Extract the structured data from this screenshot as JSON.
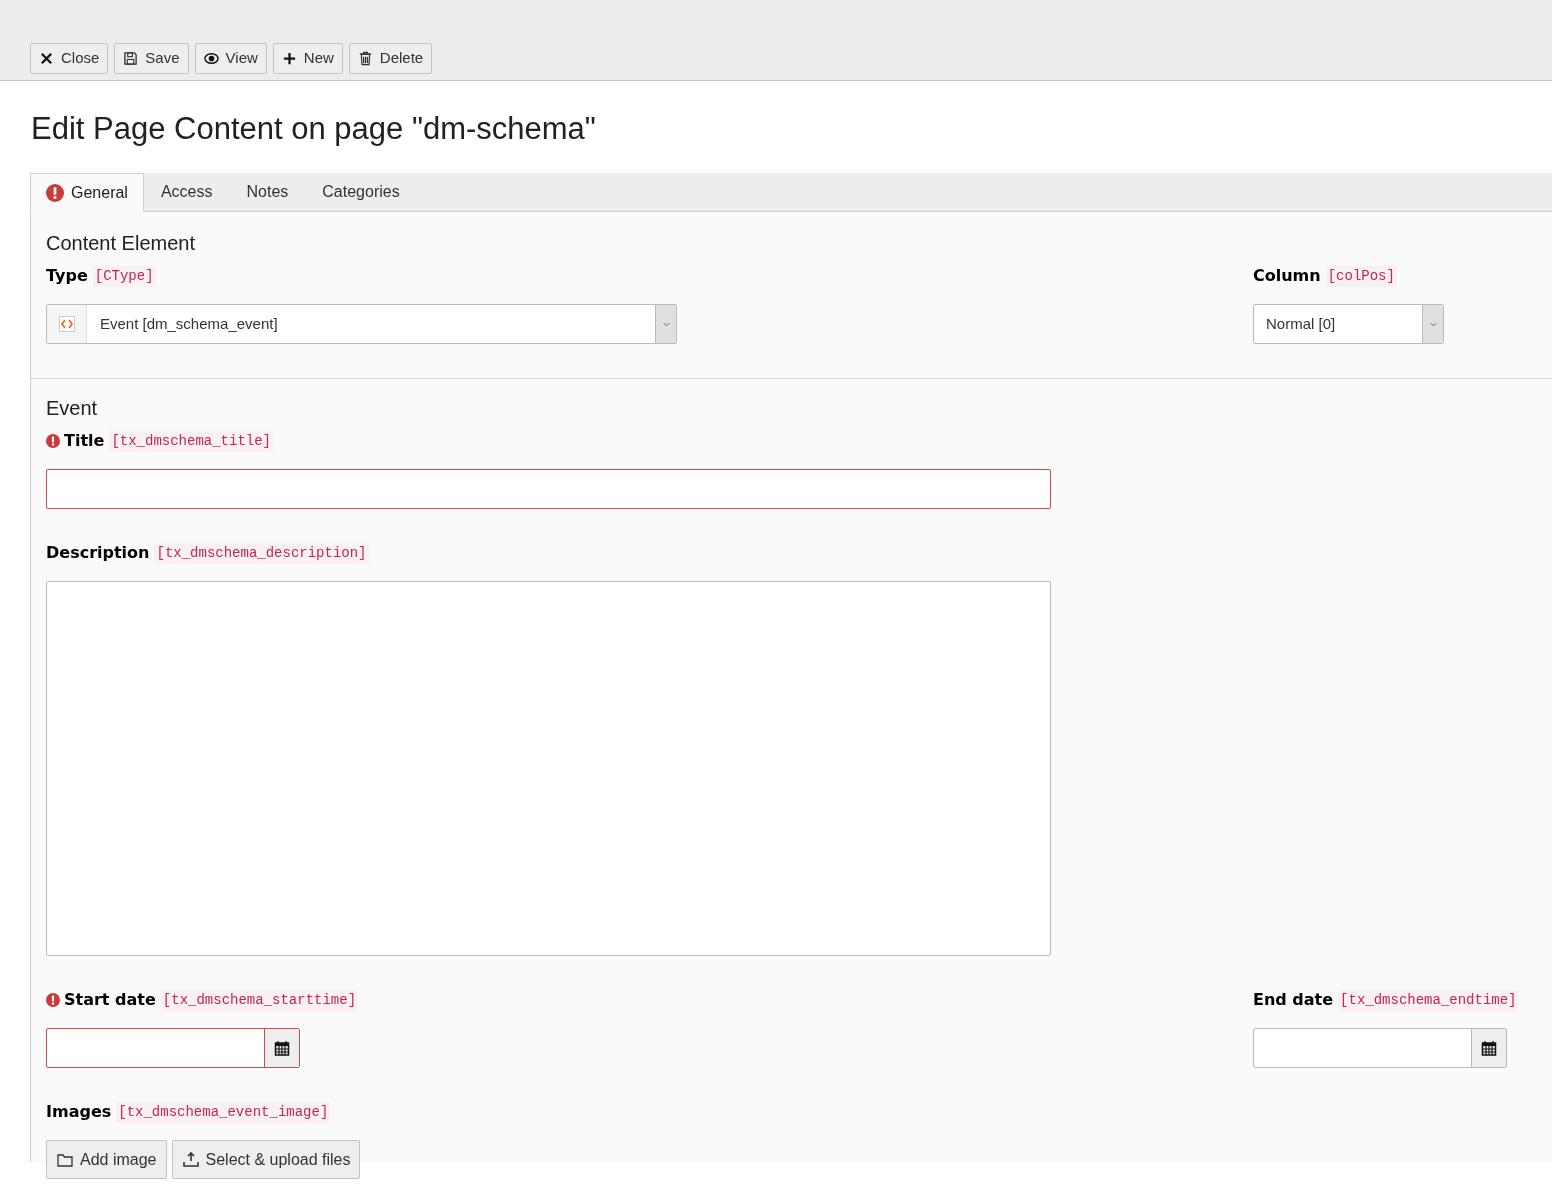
{
  "toolbar": [
    {
      "kind": "close",
      "label": "Close"
    },
    {
      "kind": "save",
      "label": "Save"
    },
    {
      "kind": "view",
      "label": "View"
    },
    {
      "kind": "new",
      "label": "New"
    },
    {
      "kind": "delete",
      "label": "Delete"
    }
  ],
  "heading": "Edit Page Content on page \"dm-schema\"",
  "tabs": [
    {
      "label": "General",
      "selected": true,
      "error": true
    },
    {
      "label": "Access",
      "selected": false,
      "error": false
    },
    {
      "label": "Notes",
      "selected": false,
      "error": false
    },
    {
      "label": "Categories",
      "selected": false,
      "error": false
    }
  ],
  "sections": [
    {
      "title": "Content Element",
      "rows": [
        [
          {
            "kind": "type-select",
            "label": "Type",
            "field": "[CType]",
            "invalid": false,
            "value": "Event [dm_schema_event]"
          },
          {
            "kind": "select",
            "label": "Column",
            "field": "[colPos]",
            "invalid": false,
            "value": "Normal [0]"
          }
        ]
      ]
    },
    {
      "title": "Event",
      "rows": [
        [
          {
            "kind": "text",
            "label": "Title",
            "field": "[tx_dmschema_title]",
            "invalid": true
          }
        ],
        [
          {
            "kind": "textarea",
            "label": "Description",
            "field": "[tx_dmschema_description]",
            "invalid": false
          }
        ],
        [
          {
            "kind": "date",
            "label": "Start date",
            "field": "[tx_dmschema_starttime]",
            "invalid": true
          },
          {
            "kind": "date",
            "label": "End date",
            "field": "[tx_dmschema_endtime]",
            "invalid": false
          }
        ],
        [
          {
            "kind": "files",
            "label": "Images",
            "field": "[tx_dmschema_event_image]",
            "invalid": false,
            "buttons": [
              {
                "kind": "add",
                "label": "Add image"
              },
              {
                "kind": "upload",
                "label": "Select & upload files"
              }
            ]
          }
        ]
      ]
    }
  ]
}
